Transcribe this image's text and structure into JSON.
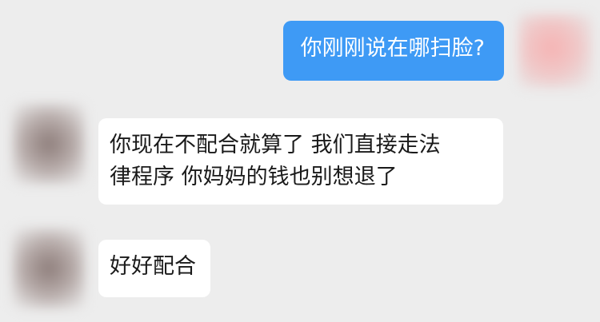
{
  "messages": {
    "outgoing_1": {
      "text": "你刚刚说在哪扫脸?"
    },
    "incoming_1": {
      "lines": [
        "你现在不配合就算了 我们直接走法",
        "律程序 你妈妈的钱也别想退了"
      ]
    },
    "incoming_2": {
      "text": "好好配合"
    }
  },
  "colors": {
    "background": "#ededed",
    "outgoing_bubble": "#3e9af5",
    "incoming_bubble": "#ffffff"
  },
  "icons": {
    "self_avatar": "avatar-icon",
    "peer_avatar": "avatar-icon"
  }
}
